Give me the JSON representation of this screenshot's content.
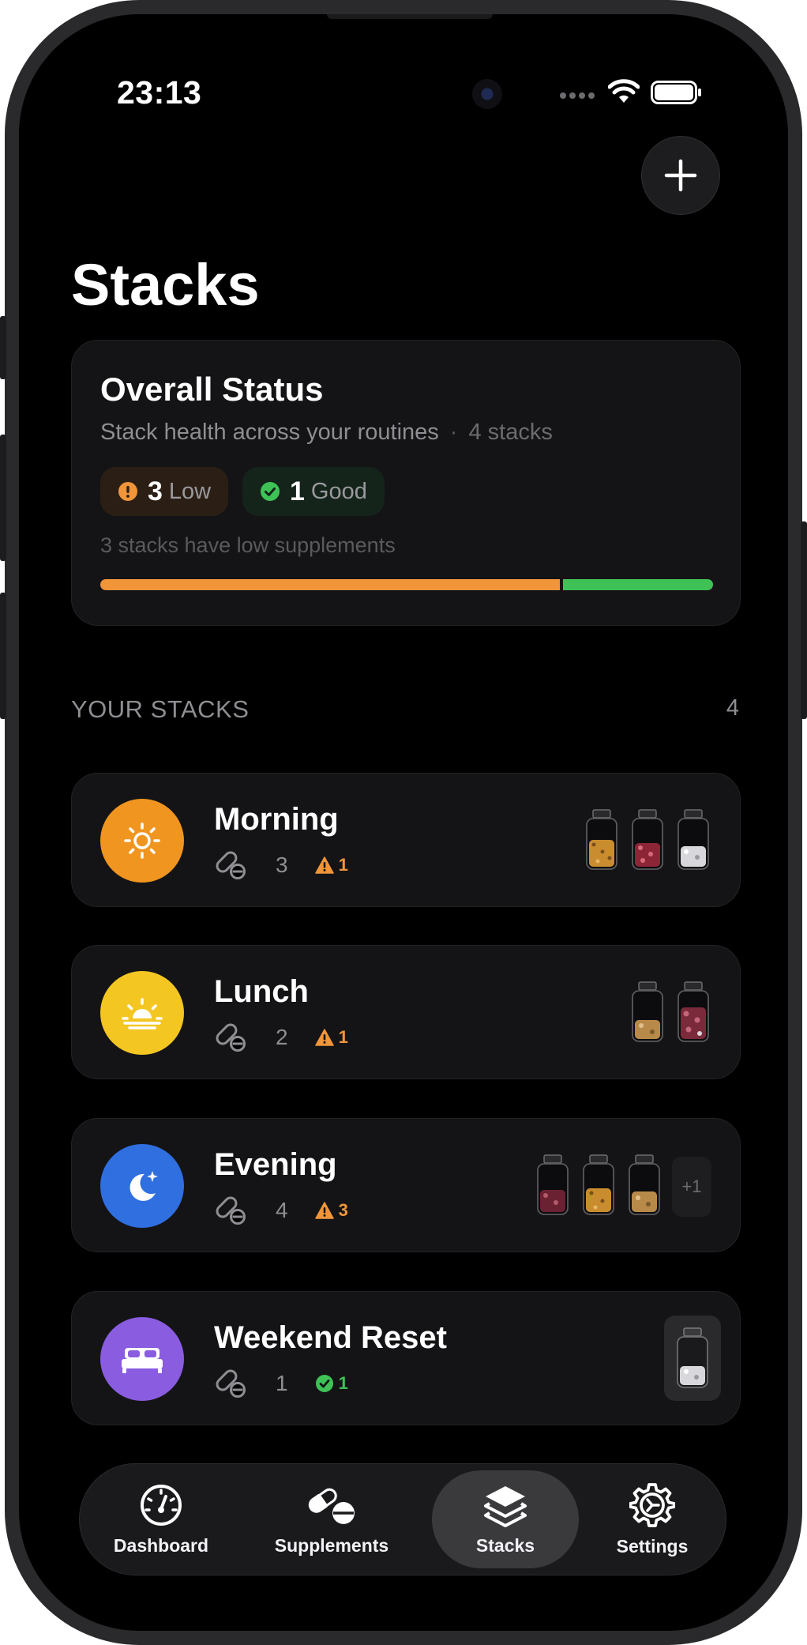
{
  "status_bar": {
    "time": "23:13"
  },
  "page": {
    "title": "Stacks"
  },
  "overall": {
    "title": "Overall Status",
    "subtitle": "Stack health across your routines",
    "separator": "·",
    "stack_count_label": "4 stacks",
    "low": {
      "count": "3",
      "label": "Low"
    },
    "good": {
      "count": "1",
      "label": "Good"
    },
    "note": "3 stacks have low supplements",
    "progress": {
      "low_fraction": 0.75,
      "good_fraction": 0.25
    }
  },
  "section": {
    "title": "YOUR STACKS",
    "count": "4"
  },
  "stacks": [
    {
      "name": "Morning",
      "count": "3",
      "alert": "1",
      "alert_type": "warning",
      "icon": "sun-icon",
      "color": "#f0951f",
      "extra": ""
    },
    {
      "name": "Lunch",
      "count": "2",
      "alert": "1",
      "alert_type": "warning",
      "icon": "sunrise-icon",
      "color": "#f4c622",
      "extra": ""
    },
    {
      "name": "Evening",
      "count": "4",
      "alert": "3",
      "alert_type": "warning",
      "icon": "moon-stars-icon",
      "color": "#2f6fe0",
      "extra": "+1"
    },
    {
      "name": "Weekend Reset",
      "count": "1",
      "alert": "1",
      "alert_type": "good",
      "icon": "bed-icon",
      "color": "#8a5ce0",
      "extra": ""
    }
  ],
  "tabs": [
    {
      "label": "Dashboard",
      "icon": "gauge-icon",
      "active": false
    },
    {
      "label": "Supplements",
      "icon": "pills-icon",
      "active": false
    },
    {
      "label": "Stacks",
      "icon": "layers-icon",
      "active": true
    },
    {
      "label": "Settings",
      "icon": "gear-icon",
      "active": false
    }
  ],
  "colors": {
    "low": "#f0953a",
    "good": "#3ec256",
    "background": "#000000",
    "card": "#141416"
  }
}
